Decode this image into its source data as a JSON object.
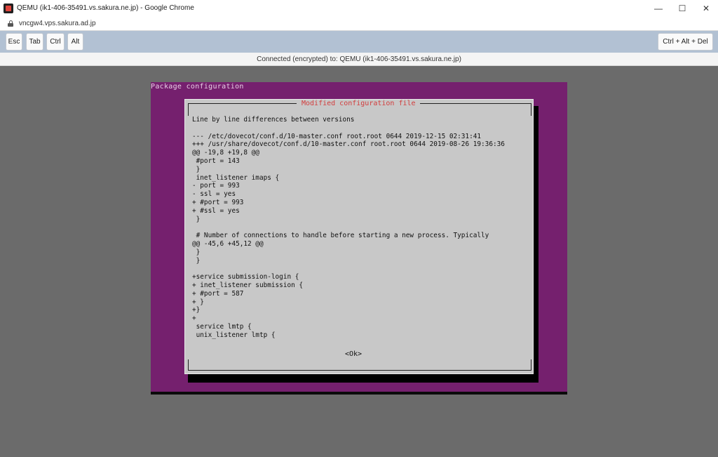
{
  "window": {
    "title": "QEMU (ik1-406-35491.vs.sakura.ne.jp) - Google Chrome",
    "minimize": "—",
    "maximize": "☐",
    "close": "✕"
  },
  "browser": {
    "url": "vncgw4.vps.sakura.ad.jp"
  },
  "toolbar": {
    "esc": "Esc",
    "tab": "Tab",
    "ctrl": "Ctrl",
    "alt": "Alt",
    "ctrl_alt_del": "Ctrl + Alt + Del"
  },
  "status": "Connected (encrypted) to: QEMU (ik1-406-35491.vs.sakura.ne.jp)",
  "vnc": {
    "background_title": "Package configuration",
    "dialog": {
      "title": "Modified configuration file",
      "lines": [
        "Line by line differences between versions",
        "",
        "--- /etc/dovecot/conf.d/10-master.conf root.root 0644 2019-12-15 02:31:41",
        "+++ /usr/share/dovecot/conf.d/10-master.conf root.root 0644 2019-08-26 19:36:36",
        "@@ -19,8 +19,8 @@",
        " #port = 143",
        " }",
        " inet_listener imaps {",
        "- port = 993",
        "- ssl = yes",
        "+ #port = 993",
        "+ #ssl = yes",
        " }",
        "",
        " # Number of connections to handle before starting a new process. Typically",
        "@@ -45,6 +45,12 @@",
        " }",
        " }",
        "",
        "+service submission-login {",
        "+ inet_listener submission {",
        "+ #port = 587",
        "+ }",
        "+}",
        "+",
        " service lmtp {",
        " unix_listener lmtp {"
      ],
      "ok_label": "<Ok>"
    }
  },
  "colors": {
    "desktop_bg": "#6b6b6b",
    "toolbar_bg": "#b2c1d3",
    "vnc_purple": "#75206e",
    "dialog_bg": "#c8c8c8",
    "dialog_title": "#d23d3d"
  }
}
